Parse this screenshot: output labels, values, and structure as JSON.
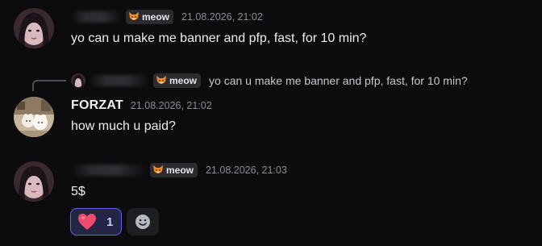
{
  "messages": [
    {
      "role_tag": "meow",
      "timestamp": "21.08.2026, 21:02",
      "text": "yo can u make me banner and pfp, fast, for 10 min?"
    },
    {
      "username": "FORZAT",
      "timestamp": "21.08.2026, 21:02",
      "text": "how much u paid?",
      "reply": {
        "role_tag": "meow",
        "text": "yo can u make me banner and pfp, fast, for 10 min?"
      }
    },
    {
      "role_tag": "meow",
      "timestamp": "21.08.2026, 21:03",
      "text": "5$",
      "reactions": [
        {
          "emoji": "heart-icon",
          "count": "1",
          "active": true
        }
      ]
    }
  ],
  "colors": {
    "background": "#0c0c0e",
    "reaction_active_border": "#5865f2",
    "heart": "#f04b6e"
  }
}
